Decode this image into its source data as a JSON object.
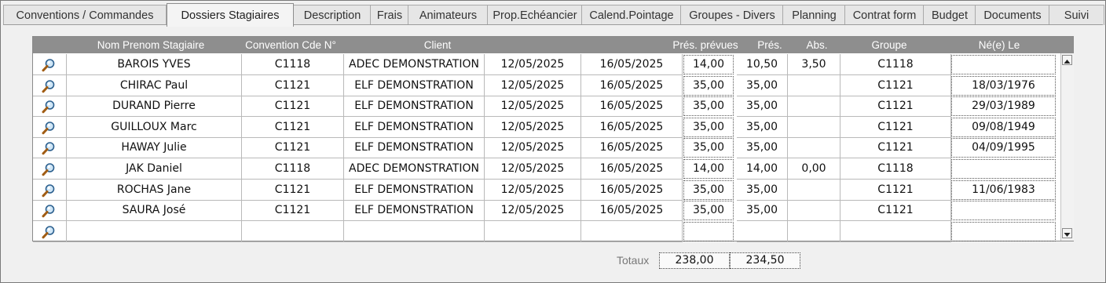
{
  "tabs": [
    {
      "label": "Conventions / Commandes",
      "active": false
    },
    {
      "label": "Dossiers Stagiaires",
      "active": true
    },
    {
      "label": "Description",
      "active": false
    },
    {
      "label": "Frais",
      "active": false
    },
    {
      "label": "Animateurs",
      "active": false
    },
    {
      "label": "Prop.Echéancier",
      "active": false
    },
    {
      "label": "Calend.Pointage",
      "active": false
    },
    {
      "label": "Groupes - Divers",
      "active": false
    },
    {
      "label": "Planning",
      "active": false
    },
    {
      "label": "Contrat form",
      "active": false
    },
    {
      "label": "Budget",
      "active": false
    },
    {
      "label": "Documents",
      "active": false
    },
    {
      "label": "Suivi",
      "active": false
    }
  ],
  "grid": {
    "headers": {
      "nom": "Nom Prenom Stagiaire",
      "convention": "Convention Cde N°",
      "client": "Client",
      "pres_prevues": "Prés. prévues",
      "pres": "Prés.",
      "abs": "Abs.",
      "groupe": "Groupe",
      "ne_le": "Né(e) Le"
    },
    "rows": [
      {
        "nom": "BAROIS YVES",
        "convention": "C1118",
        "client": "ADEC DEMONSTRATION",
        "debut": "12/05/2025",
        "fin": "16/05/2025",
        "pres_prevues": "14,00",
        "pres": "10,50",
        "abs": "3,50",
        "groupe": "C1118",
        "ne_le": ""
      },
      {
        "nom": "CHIRAC Paul",
        "convention": "C1121",
        "client": "ELF DEMONSTRATION",
        "debut": "12/05/2025",
        "fin": "16/05/2025",
        "pres_prevues": "35,00",
        "pres": "35,00",
        "abs": "",
        "groupe": "C1121",
        "ne_le": "18/03/1976"
      },
      {
        "nom": "DURAND Pierre",
        "convention": "C1121",
        "client": "ELF DEMONSTRATION",
        "debut": "12/05/2025",
        "fin": "16/05/2025",
        "pres_prevues": "35,00",
        "pres": "35,00",
        "abs": "",
        "groupe": "C1121",
        "ne_le": "29/03/1989"
      },
      {
        "nom": "GUILLOUX Marc",
        "convention": "C1121",
        "client": "ELF DEMONSTRATION",
        "debut": "12/05/2025",
        "fin": "16/05/2025",
        "pres_prevues": "35,00",
        "pres": "35,00",
        "abs": "",
        "groupe": "C1121",
        "ne_le": "09/08/1949"
      },
      {
        "nom": "HAWAY Julie",
        "convention": "C1121",
        "client": "ELF DEMONSTRATION",
        "debut": "12/05/2025",
        "fin": "16/05/2025",
        "pres_prevues": "35,00",
        "pres": "35,00",
        "abs": "",
        "groupe": "C1121",
        "ne_le": "04/09/1995"
      },
      {
        "nom": "JAK Daniel",
        "convention": "C1118",
        "client": "ADEC DEMONSTRATION",
        "debut": "12/05/2025",
        "fin": "16/05/2025",
        "pres_prevues": "14,00",
        "pres": "14,00",
        "abs": "0,00",
        "groupe": "C1118",
        "ne_le": ""
      },
      {
        "nom": "ROCHAS Jane",
        "convention": "C1121",
        "client": "ELF DEMONSTRATION",
        "debut": "12/05/2025",
        "fin": "16/05/2025",
        "pres_prevues": "35,00",
        "pres": "35,00",
        "abs": "",
        "groupe": "C1121",
        "ne_le": "11/06/1983"
      },
      {
        "nom": "SAURA José",
        "convention": "C1121",
        "client": "ELF DEMONSTRATION",
        "debut": "12/05/2025",
        "fin": "16/05/2025",
        "pres_prevues": "35,00",
        "pres": "35,00",
        "abs": "",
        "groupe": "C1121",
        "ne_le": ""
      },
      {
        "nom": "",
        "convention": "",
        "client": "",
        "debut": "",
        "fin": "",
        "pres_prevues": "",
        "pres": "",
        "abs": "",
        "groupe": "",
        "ne_le": ""
      }
    ]
  },
  "totals": {
    "label": "Totaux",
    "pres_prevues": "238,00",
    "pres": "234,50"
  },
  "icons": {
    "row_search": "magnifier-icon",
    "scroll_up": "triangle-up-icon",
    "scroll_down": "triangle-down-icon"
  }
}
